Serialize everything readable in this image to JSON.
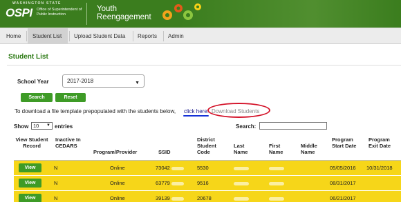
{
  "header": {
    "state_line": "WASHINGTON STATE",
    "agency_short": "OSPI",
    "agency_full": "Office of Superintendent of Public Instruction",
    "app_title_line1": "Youth",
    "app_title_line2": "Reengagement"
  },
  "nav": {
    "items": [
      {
        "label": "Home"
      },
      {
        "label": "Student List"
      },
      {
        "label": "Upload Student Data"
      },
      {
        "label": "Reports"
      },
      {
        "label": "Admin"
      }
    ],
    "active": "Student List"
  },
  "page": {
    "title": "Student List"
  },
  "filters": {
    "school_year_label": "School Year",
    "school_year_value": "2017-2018",
    "search_button": "Search",
    "reset_button": "Reset"
  },
  "download": {
    "text": "To download a file template prepopulated with the students below,",
    "link_text": "click here:",
    "action_text": "Download Students"
  },
  "table_controls": {
    "show_label": "Show",
    "page_size": "10",
    "entries_label": "entries",
    "search_label": "Search:",
    "search_value": ""
  },
  "table": {
    "headers": {
      "view": "View Student Record",
      "inactive": "Inactive In CEDARS",
      "program": "Program/Provider",
      "ssid": "SSID",
      "district_code": "District Student Code",
      "last_name": "Last Name",
      "first_name": "First Name",
      "middle_name": "Middle Name",
      "start": "Program Start Date",
      "exit": "Program Exit Date"
    },
    "view_label": "View",
    "rows": [
      {
        "inactive": "N",
        "program": "Online",
        "ssid": "73042",
        "district_code": "5530",
        "start": "05/05/2016",
        "exit": "10/31/2018"
      },
      {
        "inactive": "N",
        "program": "Online",
        "ssid": "63779",
        "district_code": "9516",
        "start": "08/31/2017",
        "exit": ""
      },
      {
        "inactive": "N",
        "program": "Online",
        "ssid": "39139",
        "district_code": "20678",
        "start": "06/21/2017",
        "exit": ""
      }
    ]
  },
  "colors": {
    "brand_green": "#3b7d1e",
    "button_green": "#3e9b26",
    "row_highlight": "#f6d619",
    "annotation_red": "#d4142a",
    "annotation_blue": "#1431d8"
  }
}
